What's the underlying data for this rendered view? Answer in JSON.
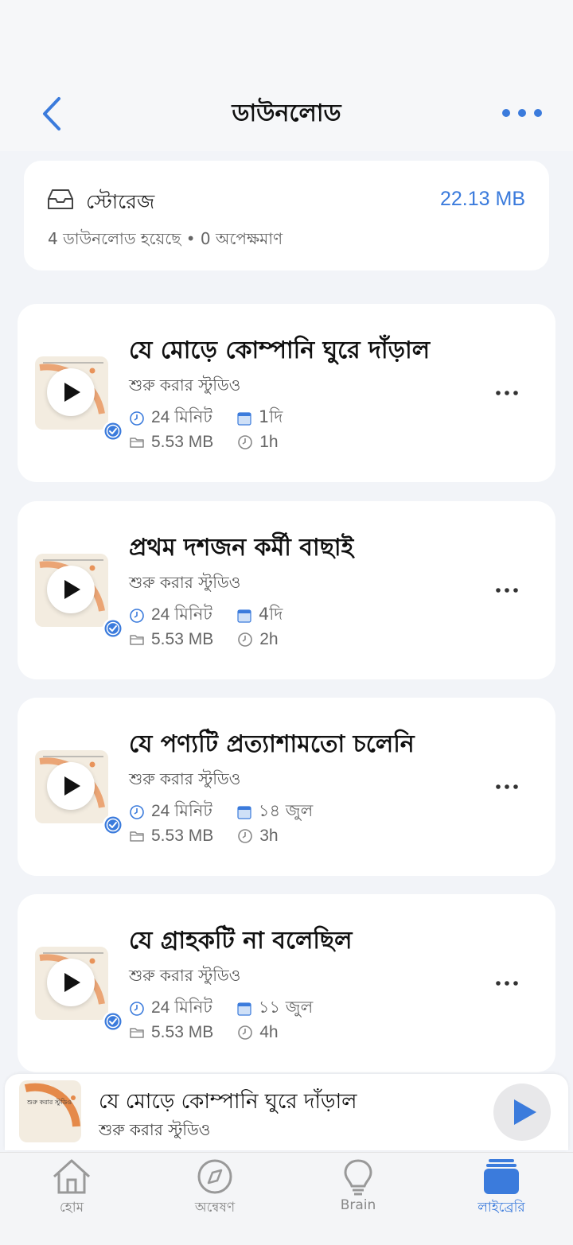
{
  "header": {
    "title": "ডাউনলোড"
  },
  "storage": {
    "label": "স্টোরেজ",
    "size": "22.13 MB",
    "summary": "4 ডাউনলোড হয়েছে • 0 অপেক্ষমাণ"
  },
  "episodes": [
    {
      "title": "যে মোড়ে কোম্পানি ঘুরে দাঁড়াল",
      "studio": "শুরু করার স্টুডিও",
      "duration": "24 মিনিট",
      "date": "1দি",
      "size": "5.53 MB",
      "ago": "1h"
    },
    {
      "title": "প্রথম দশজন কর্মী বাছাই",
      "studio": "শুরু করার স্টুডিও",
      "duration": "24 মিনিট",
      "date": "4দি",
      "size": "5.53 MB",
      "ago": "2h"
    },
    {
      "title": "যে পণ্যটি প্রত্যাশামতো চলেনি",
      "studio": "শুরু করার স্টুডিও",
      "duration": "24 মিনিট",
      "date": "১৪ জুল",
      "size": "5.53 MB",
      "ago": "3h"
    },
    {
      "title": "যে গ্রাহকটি না বলেছিল",
      "studio": "শুরু করার স্টুডিও",
      "duration": "24 মিনিট",
      "date": "১১ জুল",
      "size": "5.53 MB",
      "ago": "4h"
    }
  ],
  "mini_player": {
    "title": "যে মোড়ে কোম্পানি ঘুরে দাঁড়াল",
    "subtitle": "শুরু করার স্টুডিও",
    "thumb_text": "শুরু করার স্টুডিও"
  },
  "tabs": [
    {
      "label": "হোম",
      "icon": "home-icon"
    },
    {
      "label": "অন্বেষণ",
      "icon": "compass-icon"
    },
    {
      "label": "Brain",
      "icon": "lightbulb-icon"
    },
    {
      "label": "লাইব্রেরি",
      "icon": "library-icon"
    }
  ],
  "colors": {
    "accent": "#3b7bdc",
    "background": "#f2f4f8",
    "card": "#ffffff"
  }
}
